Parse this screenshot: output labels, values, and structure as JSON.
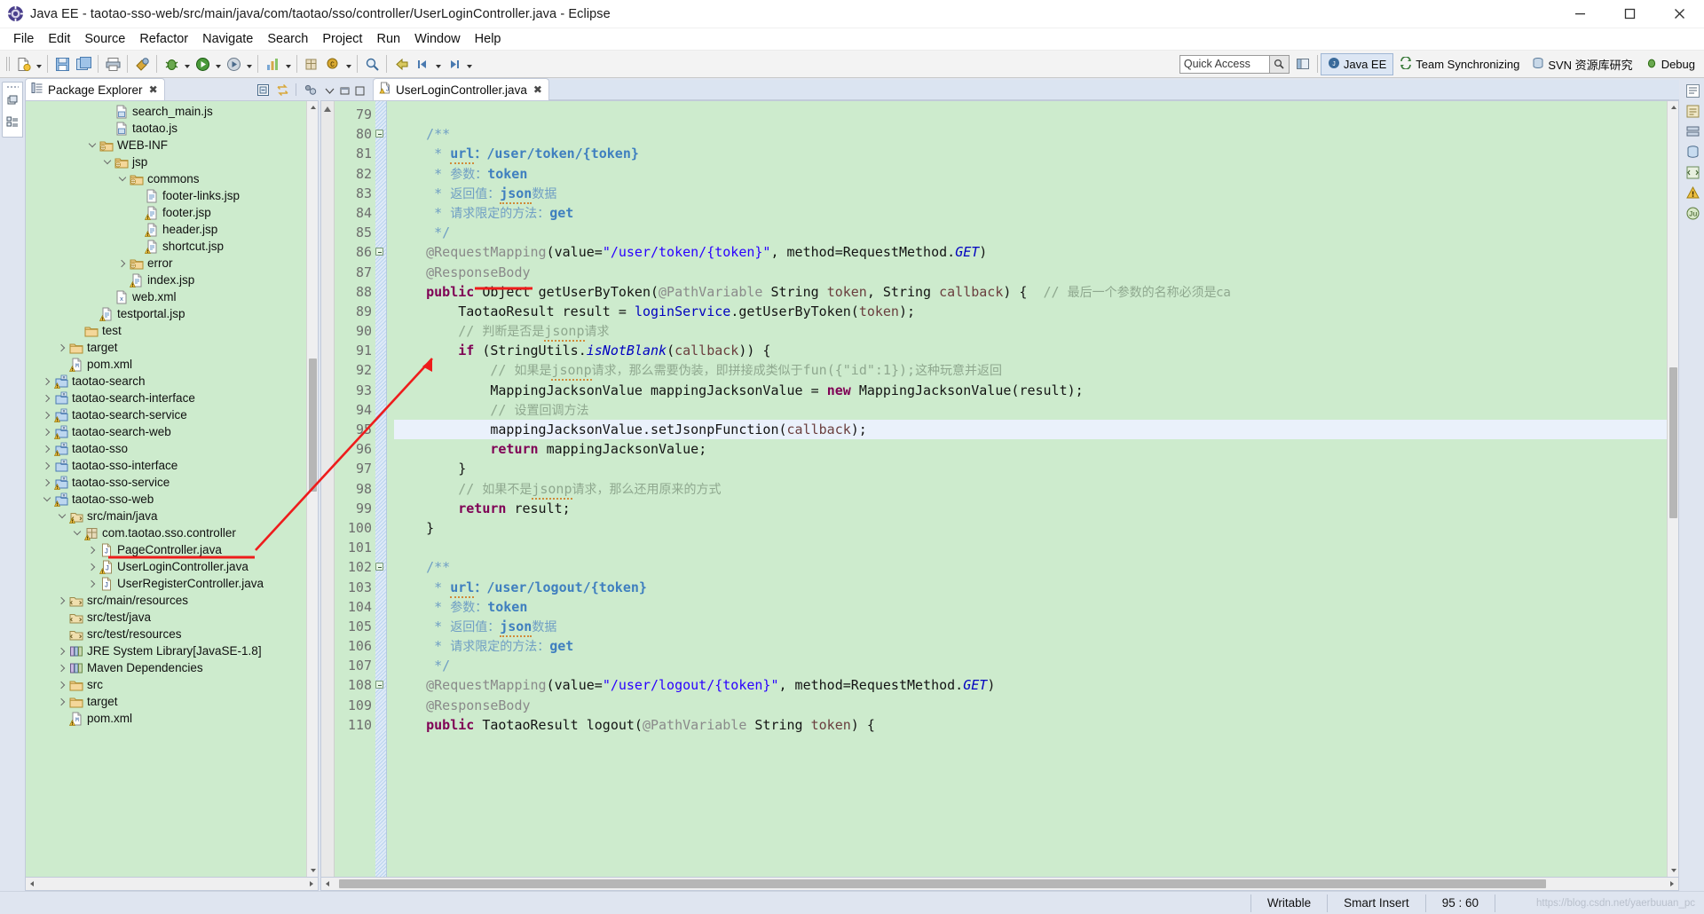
{
  "window": {
    "title": "Java EE - taotao-sso-web/src/main/java/com/taotao/sso/controller/UserLoginController.java - Eclipse",
    "minimize_label": "–",
    "maximize_label": "❐",
    "close_label": "✕"
  },
  "menu": {
    "items": [
      "File",
      "Edit",
      "Source",
      "Refactor",
      "Navigate",
      "Search",
      "Project",
      "Run",
      "Window",
      "Help"
    ]
  },
  "toolbar": {
    "quick_access_value": "Quick Access",
    "perspectives": [
      {
        "label": "Java EE",
        "active": true
      },
      {
        "label": "Team Synchronizing",
        "active": false
      },
      {
        "label": "SVN 资源库研究",
        "active": false
      },
      {
        "label": "Debug",
        "active": false
      }
    ]
  },
  "package_explorer": {
    "tab_label": "Package Explorer",
    "close_glyph": "✖",
    "tools": [
      "collapse-all-icon",
      "link-with-editor-icon",
      "view-menu-icon"
    ],
    "tree": [
      {
        "indent": 5,
        "twisty": "none",
        "icon": "js-file",
        "label": "search_main.js"
      },
      {
        "indent": 5,
        "twisty": "none",
        "icon": "js-file",
        "label": "taotao.js"
      },
      {
        "indent": 4,
        "twisty": "expanded",
        "icon": "folder-web",
        "label": "WEB-INF"
      },
      {
        "indent": 5,
        "twisty": "expanded",
        "icon": "folder-web",
        "label": "jsp"
      },
      {
        "indent": 6,
        "twisty": "expanded",
        "icon": "folder-web",
        "label": "commons"
      },
      {
        "indent": 7,
        "twisty": "none",
        "icon": "jsp-file",
        "label": "footer-links.jsp"
      },
      {
        "indent": 7,
        "twisty": "none",
        "icon": "jsp-warn",
        "label": "footer.jsp"
      },
      {
        "indent": 7,
        "twisty": "none",
        "icon": "jsp-warn",
        "label": "header.jsp"
      },
      {
        "indent": 7,
        "twisty": "none",
        "icon": "jsp-warn",
        "label": "shortcut.jsp"
      },
      {
        "indent": 6,
        "twisty": "collapsed",
        "icon": "folder-web",
        "label": "error"
      },
      {
        "indent": 6,
        "twisty": "none",
        "icon": "jsp-warn",
        "label": "index.jsp"
      },
      {
        "indent": 5,
        "twisty": "none",
        "icon": "xml-file",
        "label": "web.xml"
      },
      {
        "indent": 4,
        "twisty": "none",
        "icon": "jsp-warn",
        "label": "testportal.jsp"
      },
      {
        "indent": 3,
        "twisty": "none",
        "icon": "folder",
        "label": "test"
      },
      {
        "indent": 2,
        "twisty": "collapsed",
        "icon": "folder",
        "label": "target"
      },
      {
        "indent": 2,
        "twisty": "none",
        "icon": "pom-file",
        "label": "pom.xml"
      },
      {
        "indent": 1,
        "twisty": "collapsed",
        "icon": "maven-proj-w",
        "label": "taotao-search"
      },
      {
        "indent": 1,
        "twisty": "collapsed",
        "icon": "maven-proj",
        "label": "taotao-search-interface"
      },
      {
        "indent": 1,
        "twisty": "collapsed",
        "icon": "maven-proj-w",
        "label": "taotao-search-service"
      },
      {
        "indent": 1,
        "twisty": "collapsed",
        "icon": "maven-proj-w",
        "label": "taotao-search-web"
      },
      {
        "indent": 1,
        "twisty": "collapsed",
        "icon": "maven-proj-w",
        "label": "taotao-sso"
      },
      {
        "indent": 1,
        "twisty": "collapsed",
        "icon": "maven-proj",
        "label": "taotao-sso-interface"
      },
      {
        "indent": 1,
        "twisty": "collapsed",
        "icon": "maven-proj-w",
        "label": "taotao-sso-service"
      },
      {
        "indent": 1,
        "twisty": "expanded",
        "icon": "maven-proj-w",
        "label": "taotao-sso-web"
      },
      {
        "indent": 2,
        "twisty": "expanded",
        "icon": "src-folder-w",
        "label": "src/main/java"
      },
      {
        "indent": 3,
        "twisty": "expanded",
        "icon": "package-w",
        "label": "com.taotao.sso.controller"
      },
      {
        "indent": 4,
        "twisty": "collapsed",
        "icon": "java-file",
        "label": "PageController.java"
      },
      {
        "indent": 4,
        "twisty": "collapsed",
        "icon": "java-warn",
        "label": "UserLoginController.java",
        "annotated": true
      },
      {
        "indent": 4,
        "twisty": "collapsed",
        "icon": "java-file",
        "label": "UserRegisterController.java"
      },
      {
        "indent": 2,
        "twisty": "collapsed",
        "icon": "src-folder",
        "label": "src/main/resources"
      },
      {
        "indent": 2,
        "twisty": "none",
        "icon": "src-folder",
        "label": "src/test/java"
      },
      {
        "indent": 2,
        "twisty": "none",
        "icon": "src-folder",
        "label": "src/test/resources"
      },
      {
        "indent": 2,
        "twisty": "collapsed",
        "icon": "library",
        "label": "JRE System Library",
        "suffix": " [JavaSE-1.8]"
      },
      {
        "indent": 2,
        "twisty": "collapsed",
        "icon": "library",
        "label": "Maven Dependencies"
      },
      {
        "indent": 2,
        "twisty": "collapsed",
        "icon": "folder",
        "label": "src"
      },
      {
        "indent": 2,
        "twisty": "collapsed",
        "icon": "folder",
        "label": "target"
      },
      {
        "indent": 2,
        "twisty": "none",
        "icon": "pom-file",
        "label": "pom.xml"
      }
    ]
  },
  "editor": {
    "tab_label": "UserLoginController.java",
    "close_glyph": "✖",
    "first_line": 79,
    "current_line_number": 95,
    "lines": [
      {
        "n": 79,
        "fold": false,
        "html": ""
      },
      {
        "n": 80,
        "fold": true,
        "html": "    <span class='jdoc'>/**</span>"
      },
      {
        "n": 81,
        "fold": false,
        "html": "     <span class='jdoc'>* </span><span class='jdoc-k'><span class='wavy'>url</span></span><span class='cn jdoc-k'>：</span><span class='jdoc-k'>/user/token/{token}</span>"
      },
      {
        "n": 82,
        "fold": false,
        "html": "     <span class='jdoc'>* </span><span class='cn jdoc'>参数：</span><span class='jdoc-k'>token</span>"
      },
      {
        "n": 83,
        "fold": false,
        "html": "     <span class='jdoc'>* </span><span class='cn jdoc'>返回值：</span><span class='jdoc-k'><span class='wavy'>json</span></span><span class='cn jdoc'>数据</span>"
      },
      {
        "n": 84,
        "fold": false,
        "html": "     <span class='jdoc'>* </span><span class='cn jdoc'>请求限定的方法：</span><span class='jdoc-k'>get</span>"
      },
      {
        "n": 85,
        "fold": false,
        "html": "     <span class='jdoc'>*/</span>"
      },
      {
        "n": 86,
        "fold": true,
        "html": "    <span class='ann'>@RequestMapping</span><span class='id'>(value=</span><span class='str'>\"/user/token/{token}\"</span><span class='id'>, method=RequestMethod.</span><span class='stc'>GET</span><span class='id'>)</span>"
      },
      {
        "n": 87,
        "fold": false,
        "html": "    <span class='ann'>@ResponseBody</span>"
      },
      {
        "n": 88,
        "fold": false,
        "html": "    <span class='kw'>public</span> <span class='id'>Object</span> <span class='id'>getUserByToken</span><span class='id'>(</span><span class='ann'>@PathVariable</span> <span class='id'>String</span> <span class='par'>token</span><span class='id'>, </span><span class='id'>String</span> <span class='par'>callback</span><span class='id'>) {</span>  <span class='cmt'>// </span><span class='cmt cn'>最后一个参数的名称必须是ca</span>"
      },
      {
        "n": 89,
        "fold": false,
        "html": "        <span class='id'>TaotaoResult</span> <span class='id'>result</span> <span class='id'>= </span><span class='fld'>loginService</span><span class='id'>.getUserByToken(</span><span class='par'>token</span><span class='id'>);</span>"
      },
      {
        "n": 90,
        "fold": false,
        "html": "        <span class='cmt'>// </span><span class='cmt cn'>判断是否是</span><span class='cmt'><span class='wavy'>jsonp</span></span><span class='cmt cn'>请求</span>"
      },
      {
        "n": 91,
        "fold": false,
        "html": "        <span class='kw'>if</span> <span class='id'>(StringUtils.</span><span class='sm'>isNotBlank</span><span class='id'>(</span><span class='par'>callback</span><span class='id'>)) {</span>"
      },
      {
        "n": 92,
        "fold": false,
        "html": "            <span class='cmt'>// </span><span class='cmt cn'>如果是</span><span class='cmt'><span class='wavy'>jsonp</span></span><span class='cmt cn'>请求，那么需要伪装，即拼接成类似于</span><span class='cmt'>fun({\"id\":1});</span><span class='cmt cn'>这种玩意并返回</span>"
      },
      {
        "n": 93,
        "fold": false,
        "html": "            <span class='id'>MappingJacksonValue</span> <span class='id'>mappingJacksonValue</span> <span class='id'>= </span><span class='kw'>new</span> <span class='id'>MappingJacksonValue(</span><span class='id'>result</span><span class='id'>);</span>"
      },
      {
        "n": 94,
        "fold": false,
        "html": "            <span class='cmt'>// </span><span class='cmt cn'>设置回调方法</span>"
      },
      {
        "n": 95,
        "fold": false,
        "html": "            <span class='id'>mappingJacksonValue</span><span class='id'>.setJsonpFunction(</span><span class='par'>callback</span><span class='id'>);</span>"
      },
      {
        "n": 96,
        "fold": false,
        "html": "            <span class='kw'>return</span> <span class='id'>mappingJacksonValue</span><span class='id'>;</span>"
      },
      {
        "n": 97,
        "fold": false,
        "html": "        <span class='id'>}</span>"
      },
      {
        "n": 98,
        "fold": false,
        "html": "        <span class='cmt'>// </span><span class='cmt cn'>如果不是</span><span class='cmt'><span class='wavy'>jsonp</span></span><span class='cmt cn'>请求，那么还用原来的方式</span>"
      },
      {
        "n": 99,
        "fold": false,
        "html": "        <span class='kw'>return</span> <span class='id'>result</span><span class='id'>;</span>"
      },
      {
        "n": 100,
        "fold": false,
        "html": "    <span class='id'>}</span>"
      },
      {
        "n": 101,
        "fold": false,
        "html": ""
      },
      {
        "n": 102,
        "fold": true,
        "html": "    <span class='jdoc'>/**</span>"
      },
      {
        "n": 103,
        "fold": false,
        "html": "     <span class='jdoc'>* </span><span class='jdoc-k'><span class='wavy'>url</span></span><span class='cn jdoc-k'>：</span><span class='jdoc-k'>/user/logout/{token}</span>"
      },
      {
        "n": 104,
        "fold": false,
        "html": "     <span class='jdoc'>* </span><span class='cn jdoc'>参数：</span><span class='jdoc-k'>token</span>"
      },
      {
        "n": 105,
        "fold": false,
        "html": "     <span class='jdoc'>* </span><span class='cn jdoc'>返回值：</span><span class='jdoc-k'><span class='wavy'>json</span></span><span class='cn jdoc'>数据</span>"
      },
      {
        "n": 106,
        "fold": false,
        "html": "     <span class='jdoc'>* </span><span class='cn jdoc'>请求限定的方法：</span><span class='jdoc-k'>get</span>"
      },
      {
        "n": 107,
        "fold": false,
        "html": "     <span class='jdoc'>*/</span>"
      },
      {
        "n": 108,
        "fold": true,
        "html": "    <span class='ann'>@RequestMapping</span><span class='id'>(value=</span><span class='str'>\"/user/logout/{token}\"</span><span class='id'>, method=RequestMethod.</span><span class='stc'>GET</span><span class='id'>)</span>"
      },
      {
        "n": 109,
        "fold": false,
        "html": "    <span class='ann'>@ResponseBody</span>"
      },
      {
        "n": 110,
        "fold": false,
        "html": "    <span class='kw'>public</span> <span class='id'>TaotaoResult</span> <span class='id'>logout(</span><span class='ann'>@PathVariable</span> <span class='id'>String</span> <span class='par'>token</span><span class='id'>) {</span>"
      }
    ]
  },
  "status_bar": {
    "writable": "Writable",
    "insert_mode": "Smart Insert",
    "cursor_position": "95 : 60",
    "watermark": "https://blog.csdn.net/yaerbuuan_pc"
  },
  "annotations": {
    "accent_color": "#ee1c1c"
  }
}
